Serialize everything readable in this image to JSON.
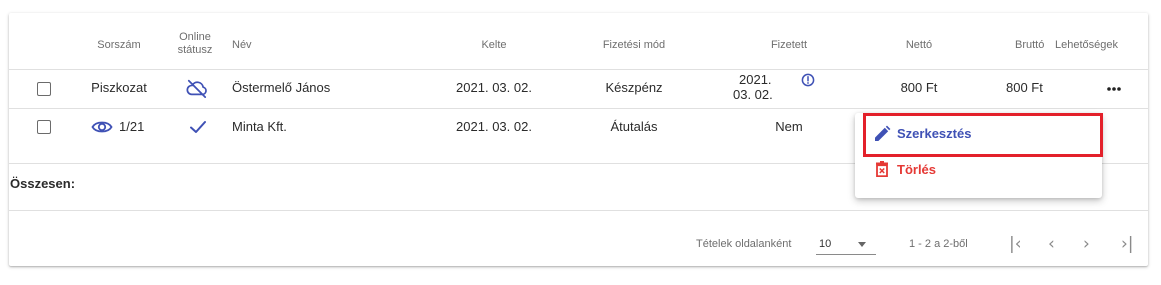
{
  "header": {
    "sorszam": "Sorszám",
    "online_line1": "Online",
    "online_line2": "státusz",
    "nev": "Név",
    "kelte": "Kelte",
    "fizetesi_mod": "Fizetési mód",
    "fizetett": "Fizetett",
    "netto": "Nettó",
    "brutto": "Bruttó",
    "lehetosegek": "Lehetőségek"
  },
  "rows": [
    {
      "sorszam": "Piszkozat",
      "online_status_icon": "cloud-off-icon",
      "nev": "Östermelő János",
      "kelte": "2021. 03. 02.",
      "fizetesi_mod": "Készpénz",
      "fizetett_line1": "2021.",
      "fizetett_line2": "03. 02.",
      "fizetett_icon": "info-icon",
      "netto": "800 Ft",
      "brutto": "800 Ft",
      "options_icon": "more-horizontal-icon"
    },
    {
      "sorszam": "1/21",
      "sorszam_icon": "eye-icon",
      "online_status_icon": "check-icon",
      "nev": "Minta Kft.",
      "kelte": "2021. 03. 02.",
      "fizetesi_mod": "Átutalás",
      "fizetett": "Nem"
    }
  ],
  "summary": {
    "label": "Összesen:"
  },
  "menu": {
    "items": [
      {
        "label": "Szerkesztés",
        "icon": "pencil-icon",
        "color": "#3f51b5"
      },
      {
        "label": "Törlés",
        "icon": "trash-icon",
        "color": "#e53935"
      }
    ]
  },
  "pagination": {
    "per_page_label": "Tételek oldalanként",
    "per_page_value": "10",
    "range_label": "1 - 2 a 2-ből"
  },
  "colors": {
    "accent": "#3f51b5",
    "danger": "#e53935",
    "highlight_box": "#e3202a"
  }
}
